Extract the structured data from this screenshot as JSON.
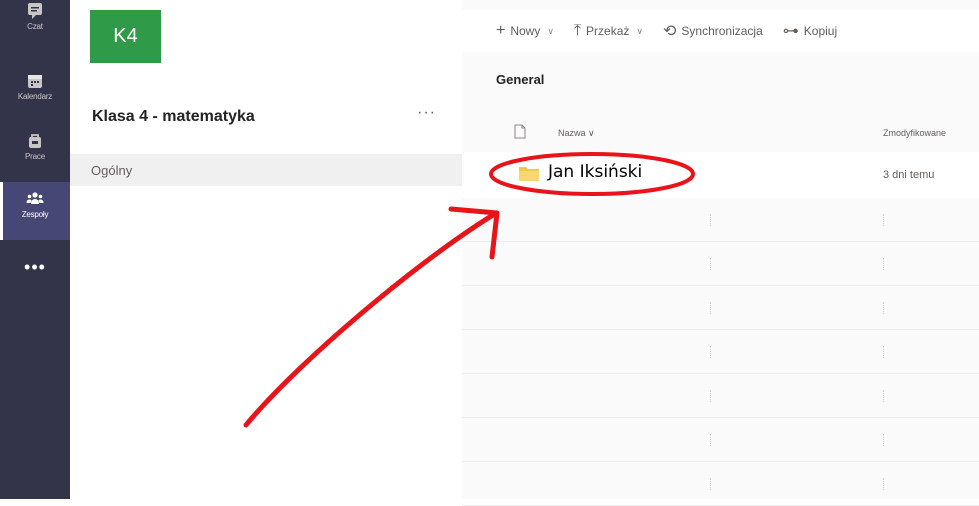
{
  "rail": {
    "items": [
      {
        "label": "Czat",
        "icon": "chat-icon"
      },
      {
        "label": "Kalendarz",
        "icon": "calendar-icon"
      },
      {
        "label": "Prace",
        "icon": "assignments-icon"
      },
      {
        "label": "Zespoły",
        "icon": "teams-icon"
      }
    ],
    "more": "•••"
  },
  "team": {
    "avatar_text": "K4",
    "name": "Klasa 4 - matematyka",
    "more": "···",
    "channel": "Ogólny"
  },
  "files": {
    "commands": [
      {
        "label": "Nowy",
        "icon": "plus-icon",
        "glyph": "+",
        "has_menu": true
      },
      {
        "label": "Przekaż",
        "icon": "upload-icon",
        "glyph": "⤒",
        "has_menu": true
      },
      {
        "label": "Synchronizacja",
        "icon": "sync-icon",
        "glyph": "⟲",
        "has_menu": false
      },
      {
        "label": "Kopiuj",
        "icon": "link-icon",
        "glyph": "⊶",
        "has_menu": false
      }
    ],
    "breadcrumb": "General",
    "columns": {
      "name": "Nazwa",
      "modified": "Zmodyfikowane"
    },
    "rows": [
      {
        "name": "Jan Iksiński",
        "modified": "3 dni temu",
        "type": "folder"
      }
    ]
  },
  "colors": {
    "rail_bg": "#33344a",
    "rail_active": "#464775",
    "team_avatar": "#2f9b48",
    "annotation": "#e8141a",
    "folder": "#f2c94c"
  }
}
